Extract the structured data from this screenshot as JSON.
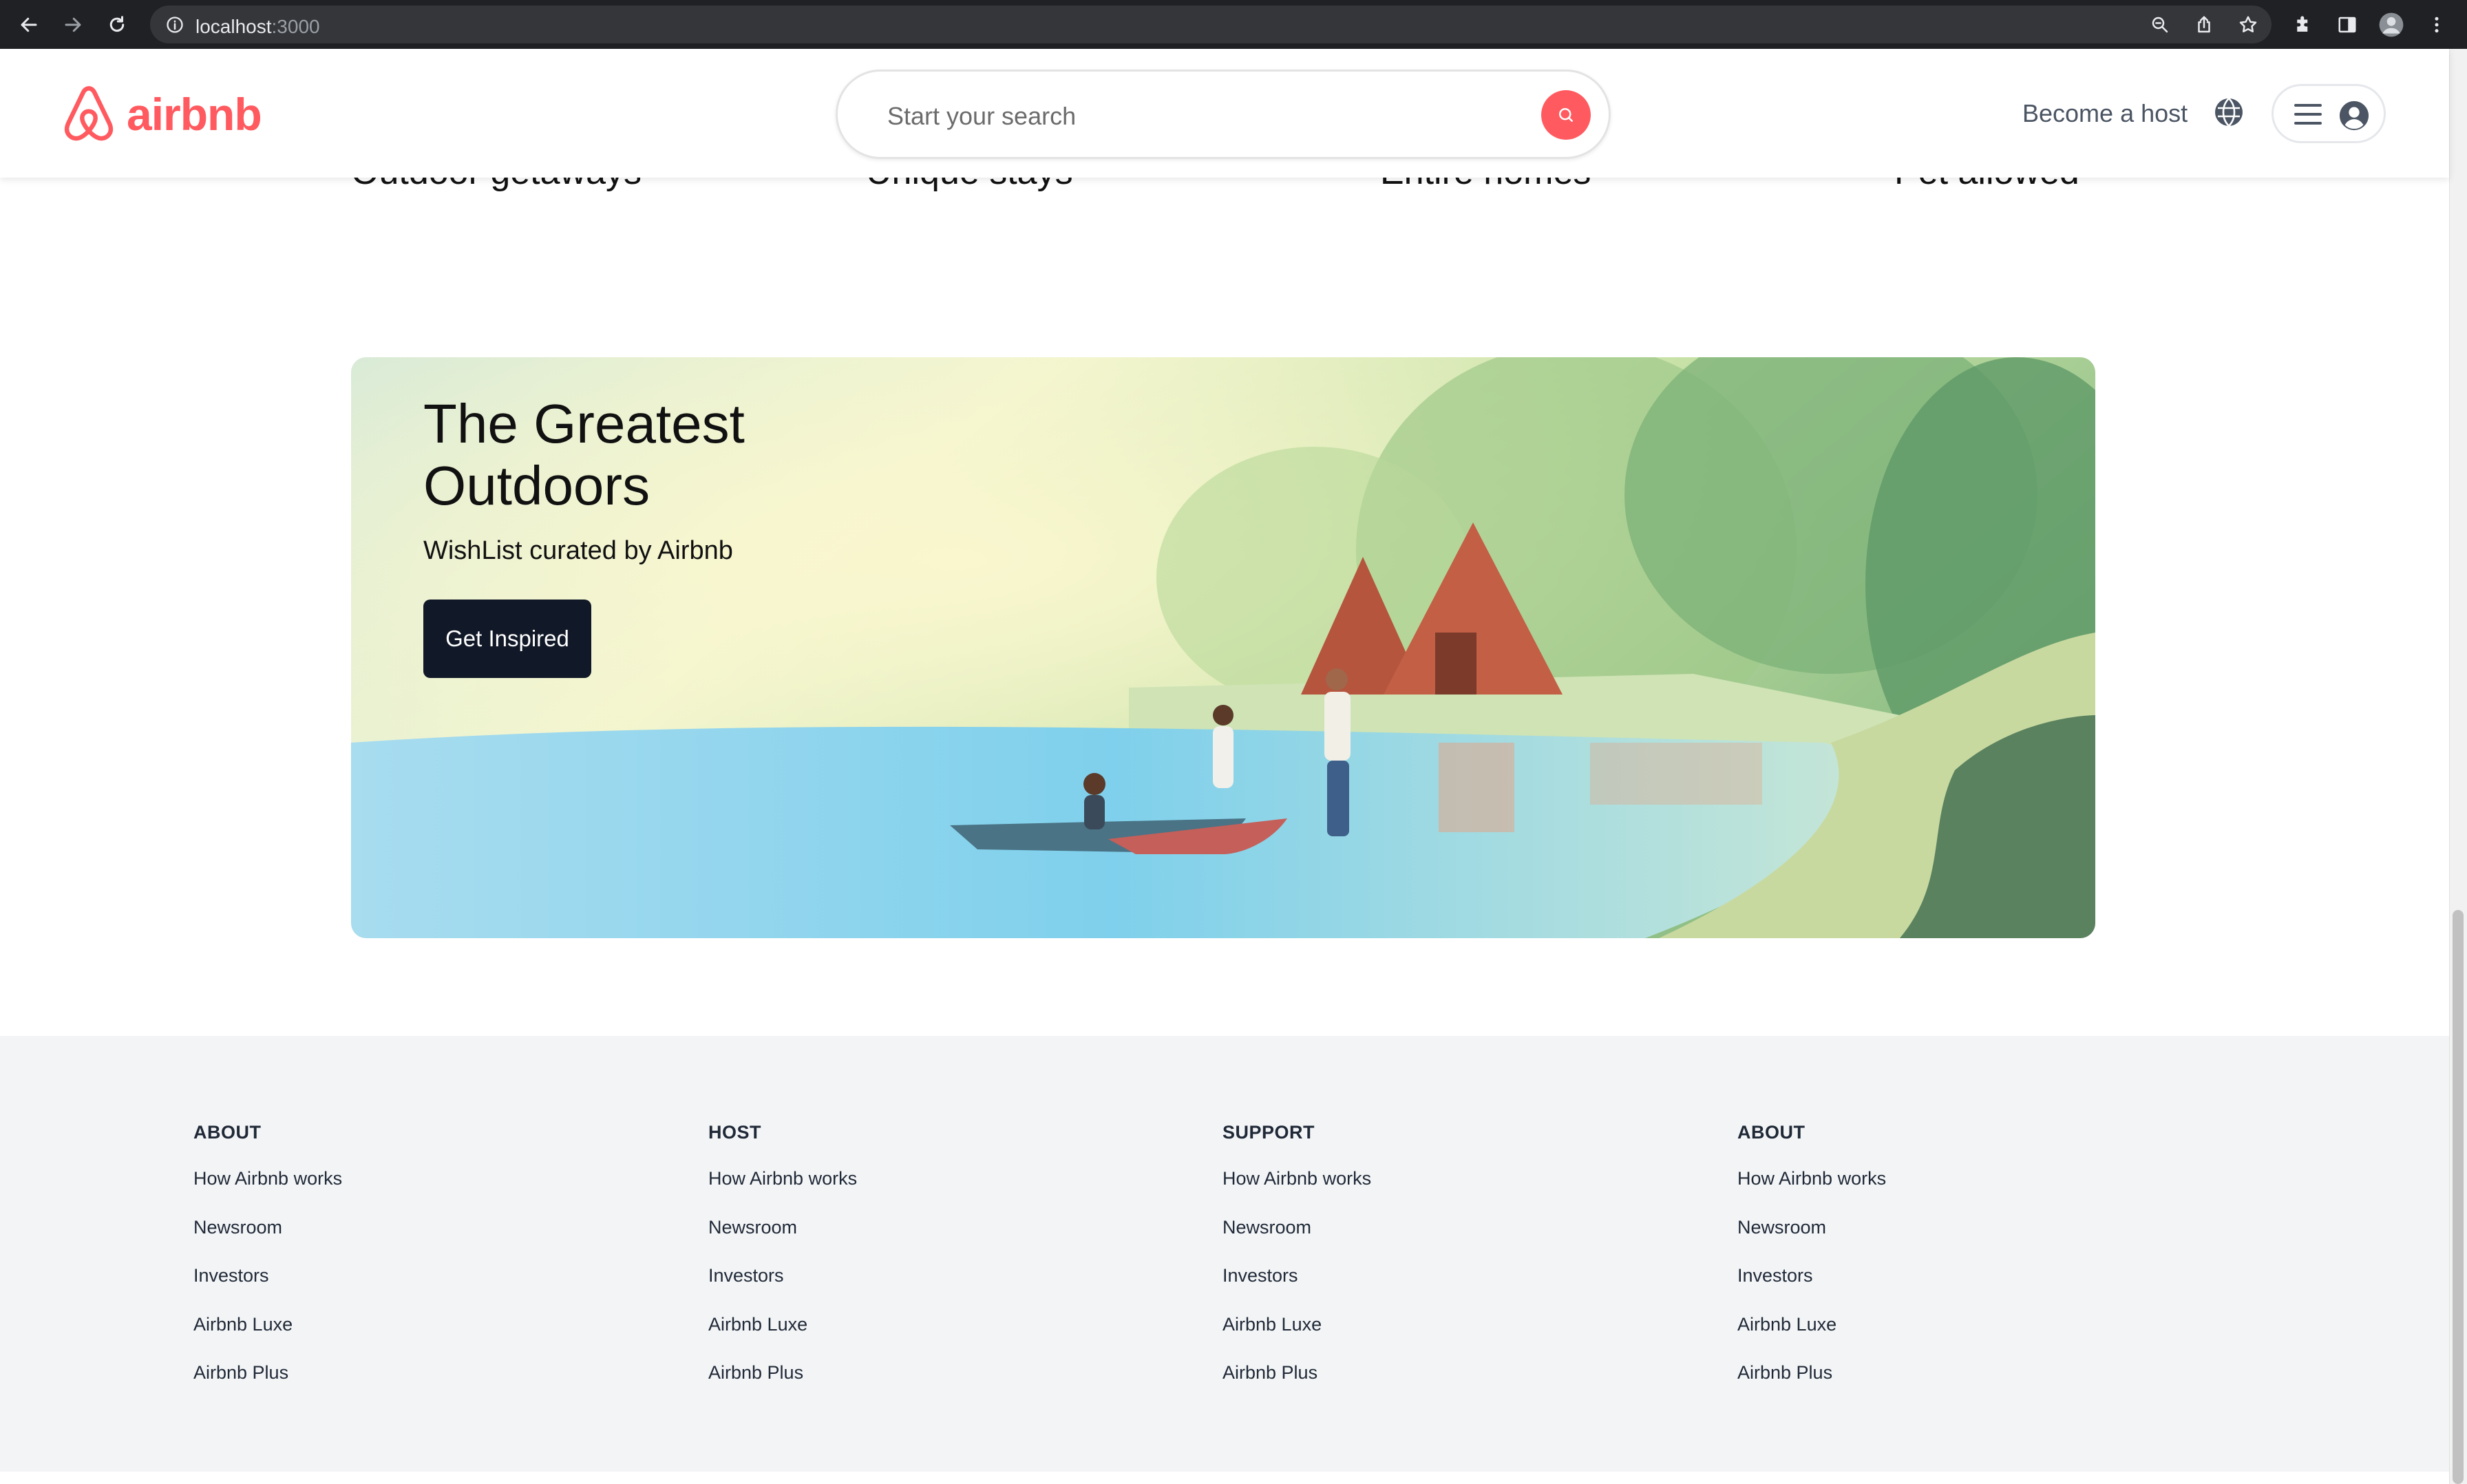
{
  "browser": {
    "url_host": "localhost",
    "url_port": ":3000"
  },
  "header": {
    "logo_text": "airbnb",
    "search_placeholder": "Start your search",
    "become_host": "Become a host"
  },
  "categories": [
    "Outdoor getaways",
    "Unique stays",
    "Entire homes",
    "Pet allowed"
  ],
  "banner": {
    "title_line1": "The Greatest",
    "title_line2": "Outdoors",
    "subtitle": "WishList curated by Airbnb",
    "button": "Get Inspired"
  },
  "footer": {
    "columns": [
      {
        "heading": "ABOUT",
        "links": [
          "How Airbnb works",
          "Newsroom",
          "Investors",
          "Airbnb Luxe",
          "Airbnb Plus"
        ]
      },
      {
        "heading": "HOST",
        "links": [
          "How Airbnb works",
          "Newsroom",
          "Investors",
          "Airbnb Luxe",
          "Airbnb Plus"
        ]
      },
      {
        "heading": "SUPPORT",
        "links": [
          "How Airbnb works",
          "Newsroom",
          "Investors",
          "Airbnb Luxe",
          "Airbnb Plus"
        ]
      },
      {
        "heading": "ABOUT",
        "links": [
          "How Airbnb works",
          "Newsroom",
          "Investors",
          "Airbnb Luxe",
          "Airbnb Plus"
        ]
      }
    ]
  },
  "colors": {
    "brand": "#ff5a5f",
    "button_dark": "#111827",
    "footer_bg": "#f3f4f6"
  },
  "icons": {
    "back": "arrow-left-icon",
    "forward": "arrow-right-icon",
    "reload": "reload-icon",
    "info": "info-icon",
    "zoom": "zoom-icon",
    "share": "share-icon",
    "bookmark": "star-icon",
    "extensions": "puzzle-icon",
    "sidebar": "sidebar-icon",
    "profile": "profile-avatar-icon",
    "kebab": "more-vertical-icon",
    "search": "search-icon",
    "globe": "globe-icon",
    "menu": "hamburger-icon",
    "user": "user-circle-icon"
  }
}
